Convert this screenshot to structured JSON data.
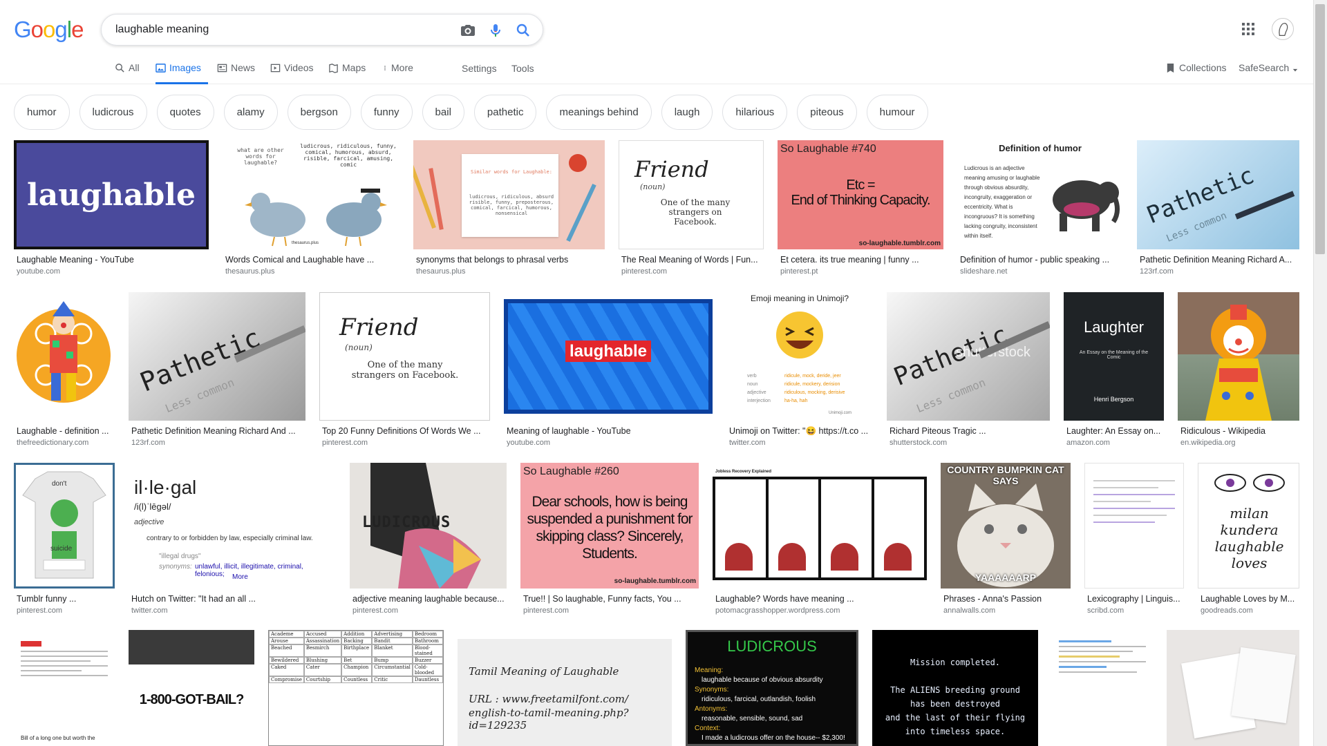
{
  "logo": [
    "G",
    "o",
    "o",
    "g",
    "l",
    "e"
  ],
  "search": {
    "query": "laughable meaning"
  },
  "tabs": {
    "all": "All",
    "images": "Images",
    "news": "News",
    "videos": "Videos",
    "maps": "Maps",
    "more": "More",
    "settings": "Settings",
    "tools": "Tools",
    "collections": "Collections",
    "safesearch": "SafeSearch"
  },
  "chips": [
    "humor",
    "ludicrous",
    "quotes",
    "alamy",
    "bergson",
    "funny",
    "bail",
    "pathetic",
    "meanings behind",
    "laugh",
    "hilarious",
    "piteous",
    "humour"
  ],
  "results": [
    {
      "caption": "Laughable Meaning - YouTube",
      "source": "youtube.com",
      "thumb_text": [
        "laughable"
      ]
    },
    {
      "caption": "Words Comical and Laughable have ...",
      "source": "thesaurus.plus",
      "thumb_text": [
        "what are other words for laughable?",
        "ludicrous, ridiculous, funny, comical, humorous, absurd, risible, farcical, amusing, comic",
        "thesaurus.plus"
      ]
    },
    {
      "caption": "synonyms that belongs to phrasal verbs",
      "source": "thesaurus.plus",
      "thumb_text": [
        "Similar words for Laughable:",
        "ludicrous, ridiculous, absurd risible, funny, preposterous, comical, farcical, humorous, nonsensical"
      ]
    },
    {
      "caption": "The Real Meaning of Words | Fun...",
      "source": "pinterest.com",
      "thumb_text": [
        "Friend",
        "(noun)",
        "One of the many strangers on Facebook."
      ]
    },
    {
      "caption": "Et cetera. its true meaning | funny ...",
      "source": "pinterest.pt",
      "thumb_text": [
        "So Laughable #740",
        "Etc =",
        "End of Thinking Capacity.",
        "so-laughable.tumblr.com"
      ]
    },
    {
      "caption": "Definition of humor - public speaking ...",
      "source": "slideshare.net",
      "thumb_text": [
        "Definition of humor",
        "Ludicrous is an adjective meaning amusing or laughable through obvious absurdity, incongruity, exaggeration or eccentricity. What is incongruous? It is something lacking congruity, inconsistent within itself."
      ]
    },
    {
      "caption": "Pathetic Definition Meaning Richard A...",
      "source": "123rf.com",
      "thumb_text": [
        "Pathetic",
        "Less common"
      ]
    },
    {
      "caption": "Laughable - definition ...",
      "source": "thefreedictionary.com",
      "thumb_text": []
    },
    {
      "caption": "Pathetic Definition Meaning Richard And ...",
      "source": "123rf.com",
      "thumb_text": [
        "Pathetic",
        "Less common"
      ]
    },
    {
      "caption": "Top 20 Funny Definitions Of Words We ...",
      "source": "pinterest.com",
      "thumb_text": [
        "Friend",
        "(noun)",
        "One of the many strangers on Facebook."
      ]
    },
    {
      "caption": "Meaning of laughable - YouTube",
      "source": "youtube.com",
      "thumb_text": [
        "laughable"
      ]
    },
    {
      "caption": "Unimoji on Twitter: \"😆 https://t.co ...",
      "source": "twitter.com",
      "thumb_text": [
        "Emoji meaning in Unimoji?",
        "verb",
        "noun",
        "adjective",
        "interjection",
        "ridicule, mock, deride, jeer",
        "ridicule, mockery, derision",
        "ridiculous, mocking, derisive",
        "ha-ha, hah",
        "Unimoji.com"
      ]
    },
    {
      "caption": "Richard Piteous Tragic ...",
      "source": "shutterstock.com",
      "thumb_text": [
        "Pathetic",
        "shutterstock",
        "Less common"
      ]
    },
    {
      "caption": "Laughter: An Essay on...",
      "source": "amazon.com",
      "thumb_text": [
        "Laughter",
        "An Essay on the Meaning of the Comic",
        "Henri Bergson"
      ]
    },
    {
      "caption": "Ridiculous - Wikipedia",
      "source": "en.wikipedia.org",
      "thumb_text": []
    },
    {
      "caption": "Tumblr funny ...",
      "source": "pinterest.com",
      "thumb_text": [
        "don't",
        "suicide"
      ]
    },
    {
      "caption": "Hutch on Twitter: \"It had an all ...",
      "source": "twitter.com",
      "thumb_text": [
        "il·le·gal",
        "/i(l)ˈlēgəl/",
        "adjective",
        "contrary to or forbidden by law, especially criminal law.",
        "\"illegal drugs\"",
        "synonyms:",
        "unlawful, illicit, illegitimate, criminal, felonious;",
        "More"
      ]
    },
    {
      "caption": "adjective meaning laughable because...",
      "source": "pinterest.com",
      "thumb_text": [
        "LUDICROUS"
      ]
    },
    {
      "caption": "True!! | So laughable, Funny facts, You ...",
      "source": "pinterest.com",
      "thumb_text": [
        "So Laughable #260",
        "Dear schools, how is being suspended a punishment for skipping class? Sincerely, Students.",
        "so-laughable.tumblr.com"
      ]
    },
    {
      "caption": "Laughable? Words have meaning ...",
      "source": "potomacgrasshopper.wordpress.com",
      "thumb_text": [
        "Jobless Recovery Explained"
      ]
    },
    {
      "caption": "Phrases - Anna's Passion",
      "source": "annalwalls.com",
      "thumb_text": [
        "COUNTRY BUMPKIN CAT SAYS",
        "YAAAAAARP"
      ]
    },
    {
      "caption": "Lexicography | Linguis...",
      "source": "scribd.com",
      "thumb_text": []
    },
    {
      "caption": "Laughable Loves by M...",
      "source": "goodreads.com",
      "thumb_text": [
        "milan kundera",
        "laughable loves"
      ]
    },
    {
      "caption": "",
      "source": "",
      "thumb_text": [
        "Bill of a long one but worth the"
      ]
    },
    {
      "caption": "",
      "source": "",
      "thumb_text": [
        "1-800-GOT-BAIL?"
      ]
    },
    {
      "caption": "",
      "source": "",
      "thumb_text": [
        "Academe",
        "Accused",
        "Addition",
        "Advertising",
        "Bedroom",
        "Arouse",
        "Assassination",
        "Backing",
        "Bandit",
        "Bathroom",
        "Beached",
        "Besmirch",
        "Birthplace",
        "Blanket",
        "Blood-stained",
        "Bewildered",
        "Blushing",
        "Bet",
        "Bump",
        "Buzzer",
        "Caked",
        "Cater",
        "Champion",
        "Circumstantial",
        "Cold-blooded",
        "Compromise",
        "Courtship",
        "Countless",
        "Critic",
        "Dauntless"
      ]
    },
    {
      "caption": "",
      "source": "",
      "thumb_text": [
        "Tamil Meaning of Laughable",
        "URL : www.freetamilfont.com/",
        "english-to-tamil-meaning.php?id=129235"
      ]
    },
    {
      "caption": "",
      "source": "",
      "thumb_text": [
        "LUDICROUS",
        "Meaning:",
        "laughable because of obvious absurdity",
        "Synonyms:",
        "ridiculous, farcical, outlandish, foolish",
        "Antonyms:",
        "reasonable, sensible, sound, sad",
        "Context:",
        "I made a ludicrous offer on the house-- $2,300!"
      ]
    },
    {
      "caption": "",
      "source": "",
      "thumb_text": [
        "Mission completed.",
        "The ALIENS breeding ground",
        "has been destroyed",
        "and the last of their flying",
        "into timeless space."
      ]
    },
    {
      "caption": "",
      "source": "",
      "thumb_text": []
    },
    {
      "caption": "",
      "source": "",
      "thumb_text": []
    }
  ],
  "colors": {
    "accent": "#1a73e8",
    "google_blue": "#4285f4",
    "google_red": "#ea4335",
    "google_yellow": "#fbbc05",
    "google_green": "#34a853"
  }
}
